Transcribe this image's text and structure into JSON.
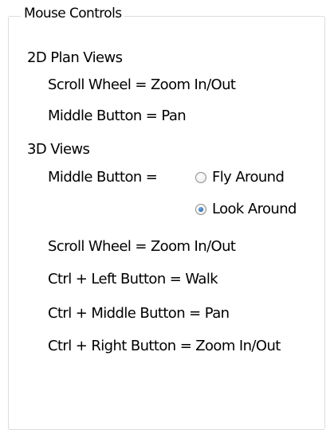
{
  "group": {
    "title": "Mouse Controls"
  },
  "plan_views": {
    "heading": "2D Plan Views",
    "scroll_wheel": "Scroll Wheel = Zoom In/Out",
    "middle_button": "Middle Button = Pan"
  },
  "views_3d": {
    "heading": "3D Views",
    "middle_button_label": "Middle Button =",
    "options": [
      {
        "label": "Fly Around",
        "selected": false
      },
      {
        "label": "Look Around",
        "selected": true
      }
    ],
    "scroll_wheel": "Scroll Wheel = Zoom In/Out",
    "ctrl_left": "Ctrl + Left Button = Walk",
    "ctrl_middle": "Ctrl + Middle Button = Pan",
    "ctrl_right": "Ctrl + Right Button = Zoom In/Out"
  }
}
